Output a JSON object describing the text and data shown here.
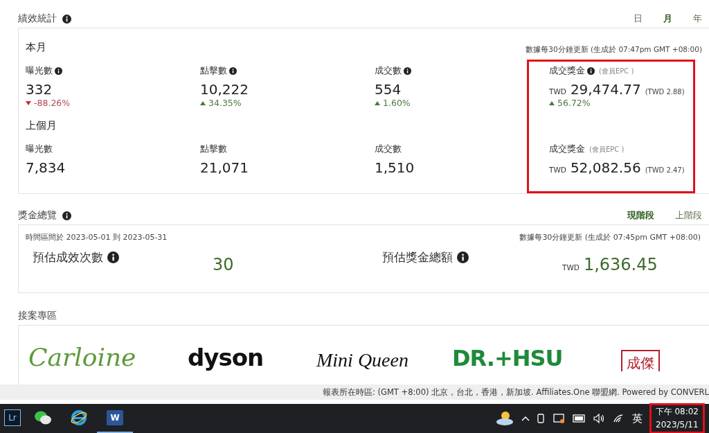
{
  "performance": {
    "title": "績效統計",
    "periods": [
      {
        "label": "日",
        "selected": false
      },
      {
        "label": "月",
        "selected": true
      },
      {
        "label": "年",
        "selected": false
      }
    ],
    "highlighted": true,
    "months": [
      {
        "heading": "本月",
        "note": "數據每30分鐘更新 (生成於 07:47pm GMT +08:00)",
        "metrics": [
          {
            "label": "曝光數",
            "info": true,
            "value": "332",
            "change": "-88.26%",
            "rising": false
          },
          {
            "label": "點擊數",
            "info": true,
            "value": "10,222",
            "change": "34.35%",
            "rising": true
          },
          {
            "label": "成交數",
            "info": true,
            "value": "554",
            "change": "1.60%",
            "rising": true
          },
          {
            "label": "成交獎金",
            "info": true,
            "sub": "(會員EPC )",
            "currency": "TWD",
            "value": "29,474.77",
            "epc": "(TWD  2.88)",
            "change": "56.72%",
            "rising": true
          }
        ]
      },
      {
        "heading": "上個月",
        "metrics": [
          {
            "label": "曝光數",
            "info": false,
            "value": "7,834"
          },
          {
            "label": "點擊數",
            "info": false,
            "value": "21,071"
          },
          {
            "label": "成交數",
            "info": false,
            "value": "1,510"
          },
          {
            "label": "成交獎金",
            "info": false,
            "sub": "(會員EPC )",
            "currency": "TWD",
            "value": "52,082.56",
            "epc": "(TWD  2.47)"
          }
        ]
      }
    ]
  },
  "bonus": {
    "title": "獎金總覽",
    "stages": [
      {
        "label": "現階段",
        "selected": true
      },
      {
        "label": "上階段",
        "selected": false
      }
    ],
    "range": "時間區間於 2023-05-01 到 2023-05-31",
    "note": "數據每30分鐘更新 (生成於 07:45pm GMT +08:00)",
    "items": [
      {
        "label": "預估成效次數",
        "value": "30"
      },
      {
        "label": "預估獎金總額",
        "currency": "TWD",
        "value": "1,636.45"
      }
    ]
  },
  "campaigns": {
    "title": "接案專區",
    "brands": [
      {
        "kind": "script",
        "name": "Carloine"
      },
      {
        "kind": "bold",
        "name": "dyson"
      },
      {
        "kind": "crown",
        "name": "Mini Queen"
      },
      {
        "kind": "block",
        "name": "DR.+HSU"
      },
      {
        "kind": "seal",
        "name": "成傑"
      }
    ]
  },
  "footer": {
    "text": "報表所在時區: (GMT +8:00) 北京，台北，香港，新加坡. Affiliates.One 聯盟網. Powered by CONVERL"
  },
  "taskbar": {
    "apps": [
      {
        "kind": "lr",
        "label": "Lr",
        "active": false
      },
      {
        "kind": "wechat",
        "active": false
      },
      {
        "kind": "ie",
        "active": false
      },
      {
        "kind": "word",
        "label": "W",
        "active": true
      }
    ],
    "ime": "英",
    "time": "下午 08:02",
    "date": "2023/5/11",
    "highlighted": true
  }
}
